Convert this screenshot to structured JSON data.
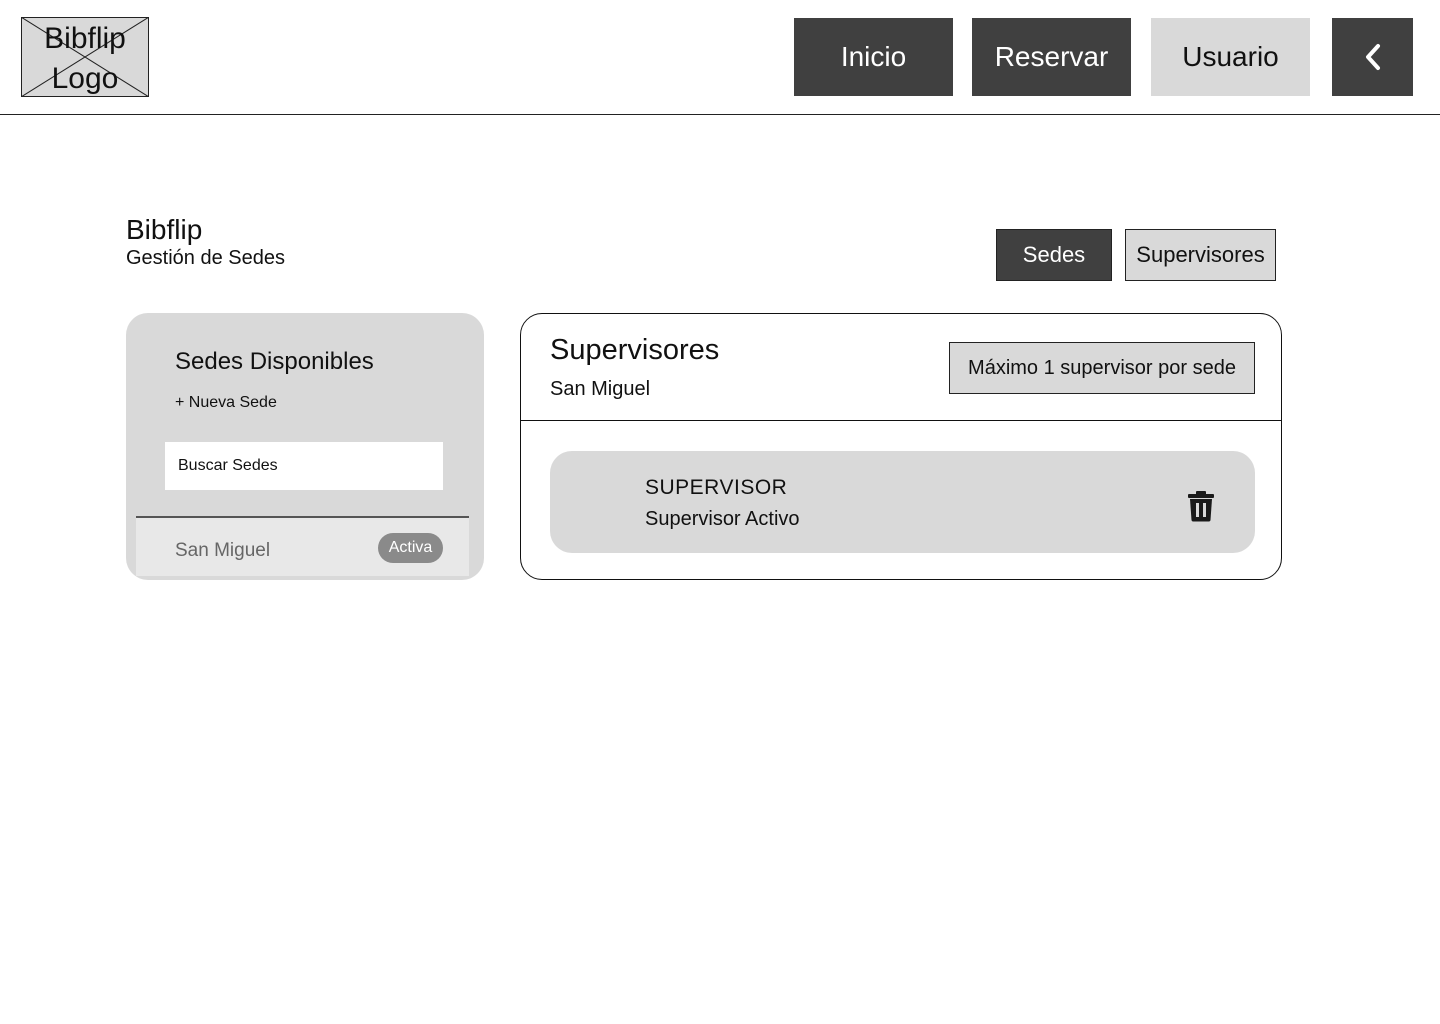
{
  "header": {
    "logo_line1": "Bibflip",
    "logo_line2": "Logo",
    "nav": {
      "inicio": "Inicio",
      "reservar": "Reservar",
      "usuario": "Usuario"
    },
    "back_icon": "chevron-left-icon"
  },
  "page": {
    "title": "Bibflip",
    "subtitle": "Gestión de Sedes",
    "tabs": {
      "sedes": "Sedes",
      "supervisores": "Supervisores"
    }
  },
  "sidebar": {
    "title": "Sedes Disponibles",
    "new_label": "+ Nueva Sede",
    "search_placeholder": "Buscar Sedes",
    "items": [
      {
        "name": "San Miguel",
        "badge": "Activa"
      }
    ]
  },
  "main": {
    "title": "Supervisores",
    "sede": "San Miguel",
    "note": "Máximo 1 supervisor por sede",
    "supervisors": [
      {
        "role": "SUPERVISOR",
        "status": "Supervisor Activo",
        "action_icon": "trash-icon"
      }
    ]
  },
  "colors": {
    "dark": "#404040",
    "light": "#d9d9d9",
    "badge": "#8a8a8a"
  }
}
